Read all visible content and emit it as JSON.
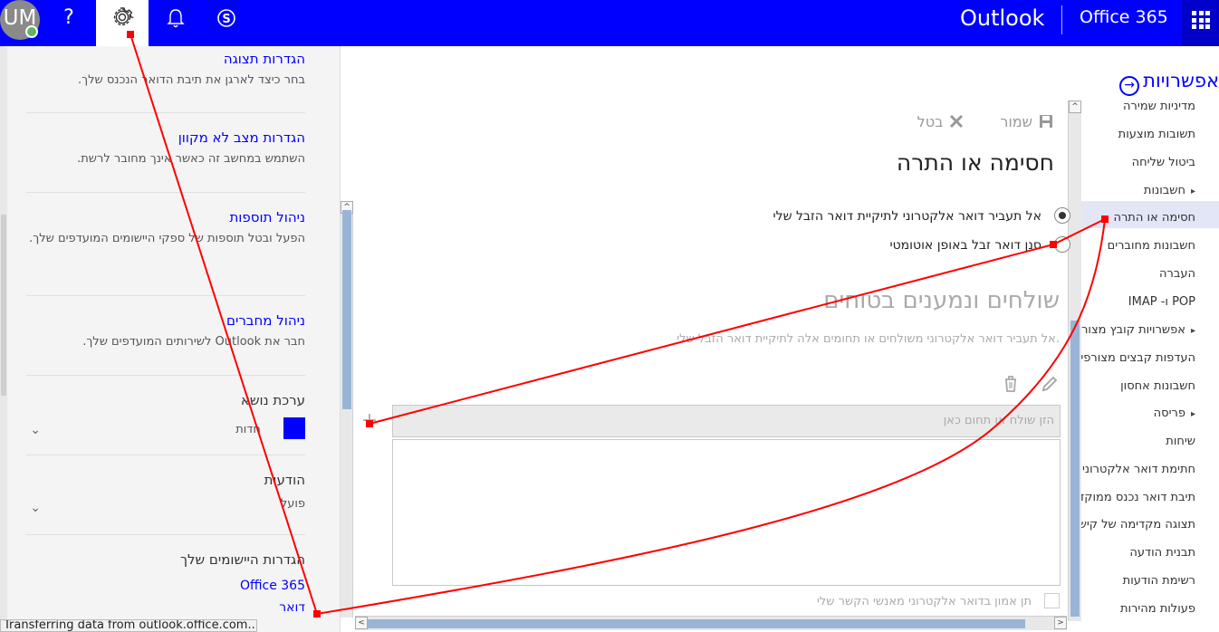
{
  "topbar": {
    "avatar_initials": "UM",
    "help_label": "?",
    "app_name": "Outlook",
    "suite_name": "Office 365"
  },
  "settings_pane": {
    "blocks": [
      {
        "title": "הגדרות תצוגה",
        "desc": "בחר כיצד לארגן את תיבת הדואר הנכנס שלך."
      },
      {
        "title": "הגדרות מצב לא מקוון",
        "desc": "השתמש במחשב זה כאשר אינך מחובר לרשת."
      },
      {
        "title": "ניהול תוספות",
        "desc": "הפעל ובטל תוספות של ספקי היישומים המועדפים שלך."
      },
      {
        "title": "ניהול מחברים",
        "desc": "חבר את Outlook לשירותים המועדפים שלך."
      }
    ],
    "theme": {
      "title": "ערכת נושא",
      "value": "חדות",
      "color": "#0000ff"
    },
    "notifications": {
      "title": "הודעות",
      "value": "פועל"
    },
    "apps": {
      "title": "הגדרות היישומים שלך",
      "links": [
        "Office 365",
        "דואר"
      ]
    }
  },
  "status_bar": "Transferring data from outlook.office.com...",
  "main": {
    "toolbar": {
      "save": "שמור",
      "cancel": "בטל"
    },
    "page_title": "חסימה או התרה",
    "radios": [
      {
        "label": "אל תעביר דואר אלקטרוני לתיקיית דואר הזבל שלי",
        "selected": true
      },
      {
        "label": "סנן דואר זבל באופן אוטומטי",
        "selected": false
      }
    ],
    "section_title": "שולחים ונמענים בטוחים",
    "section_desc": "אל תעביר דואר אלקטרוני משולחים או תחומים אלה לתיקיית דואר הזבל שלי.",
    "entry_placeholder": "הזן שולח או תחום כאן",
    "add_symbol": "+",
    "trust_contacts": "תן אמון בדואר אלקטרוני מאנשי הקשר שלי"
  },
  "right_nav": {
    "header": "אפשרויות",
    "items": [
      {
        "label": "מדיניות שמירה",
        "group": false
      },
      {
        "label": "תשובות מוצעות",
        "group": false
      },
      {
        "label": "ביטול שליחה",
        "group": false
      },
      {
        "label": "חשבונות",
        "group": true
      },
      {
        "label": "חסימה או התרה",
        "group": false,
        "selected": true
      },
      {
        "label": "חשבונות מחוברים",
        "group": false
      },
      {
        "label": "העברה",
        "group": false
      },
      {
        "label": "POP ו- IMAP",
        "group": false
      },
      {
        "label": "אפשרויות קובץ מצורף",
        "group": true
      },
      {
        "label": "העדפות קבצים מצורפים",
        "group": false
      },
      {
        "label": "חשבונות אחסון",
        "group": false
      },
      {
        "label": "פריסה",
        "group": true
      },
      {
        "label": "שיחות",
        "group": false
      },
      {
        "label": "חתימת דואר אלקטרוני",
        "group": false
      },
      {
        "label": "תיבת דואר נכנס ממוקדת",
        "group": false
      },
      {
        "label": "תצוגה מקדימה של קישור",
        "group": false
      },
      {
        "label": "תבנית הודעה",
        "group": false
      },
      {
        "label": "רשימת הודעות",
        "group": false
      },
      {
        "label": "פעולות מהירות",
        "group": false
      }
    ]
  },
  "colors": {
    "brand": "#0000ff",
    "annotation": "#ff0000"
  }
}
